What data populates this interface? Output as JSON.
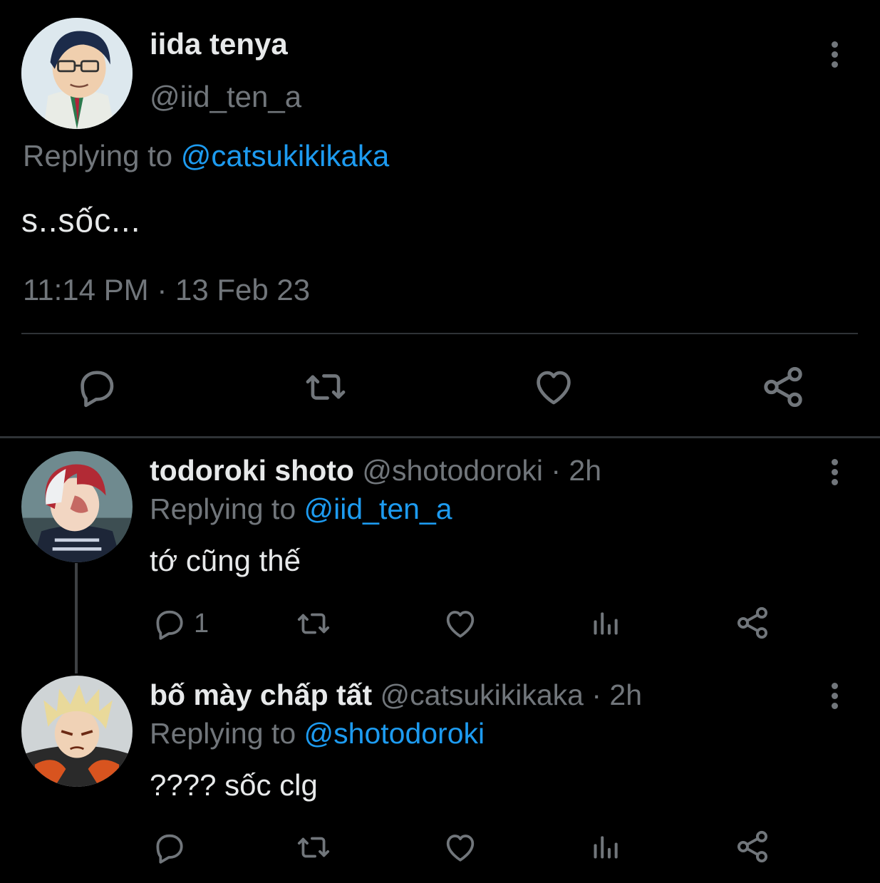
{
  "main_tweet": {
    "author_name": "iida tenya",
    "author_handle": "@iid_ten_a",
    "replying_prefix": "Replying to",
    "replying_to": "@catsukikikaka",
    "text": "s..sốc...",
    "timestamp": "11:14 PM · 13 Feb 23",
    "actions": [
      "reply-icon",
      "retweet-icon",
      "like-icon",
      "share-icon"
    ]
  },
  "replies": [
    {
      "author_name": "todoroki shoto",
      "author_handle": "@shotodoroki",
      "time": "· 2h",
      "replying_prefix": "Replying to",
      "replying_to": "@iid_ten_a",
      "text": "tớ cũng thế",
      "reply_count": "1"
    },
    {
      "author_name": "bố mày chấp tất",
      "author_handle": "@catsukikikaka",
      "time": "· 2h",
      "replying_prefix": "Replying to",
      "replying_to": "@shotodoroki",
      "text": "???? sốc clg",
      "reply_count": ""
    }
  ],
  "colors": {
    "background": "#000000",
    "text_primary": "#e7e9ea",
    "text_secondary": "#71767b",
    "accent": "#1d9bf0",
    "divider": "#2f3336"
  }
}
